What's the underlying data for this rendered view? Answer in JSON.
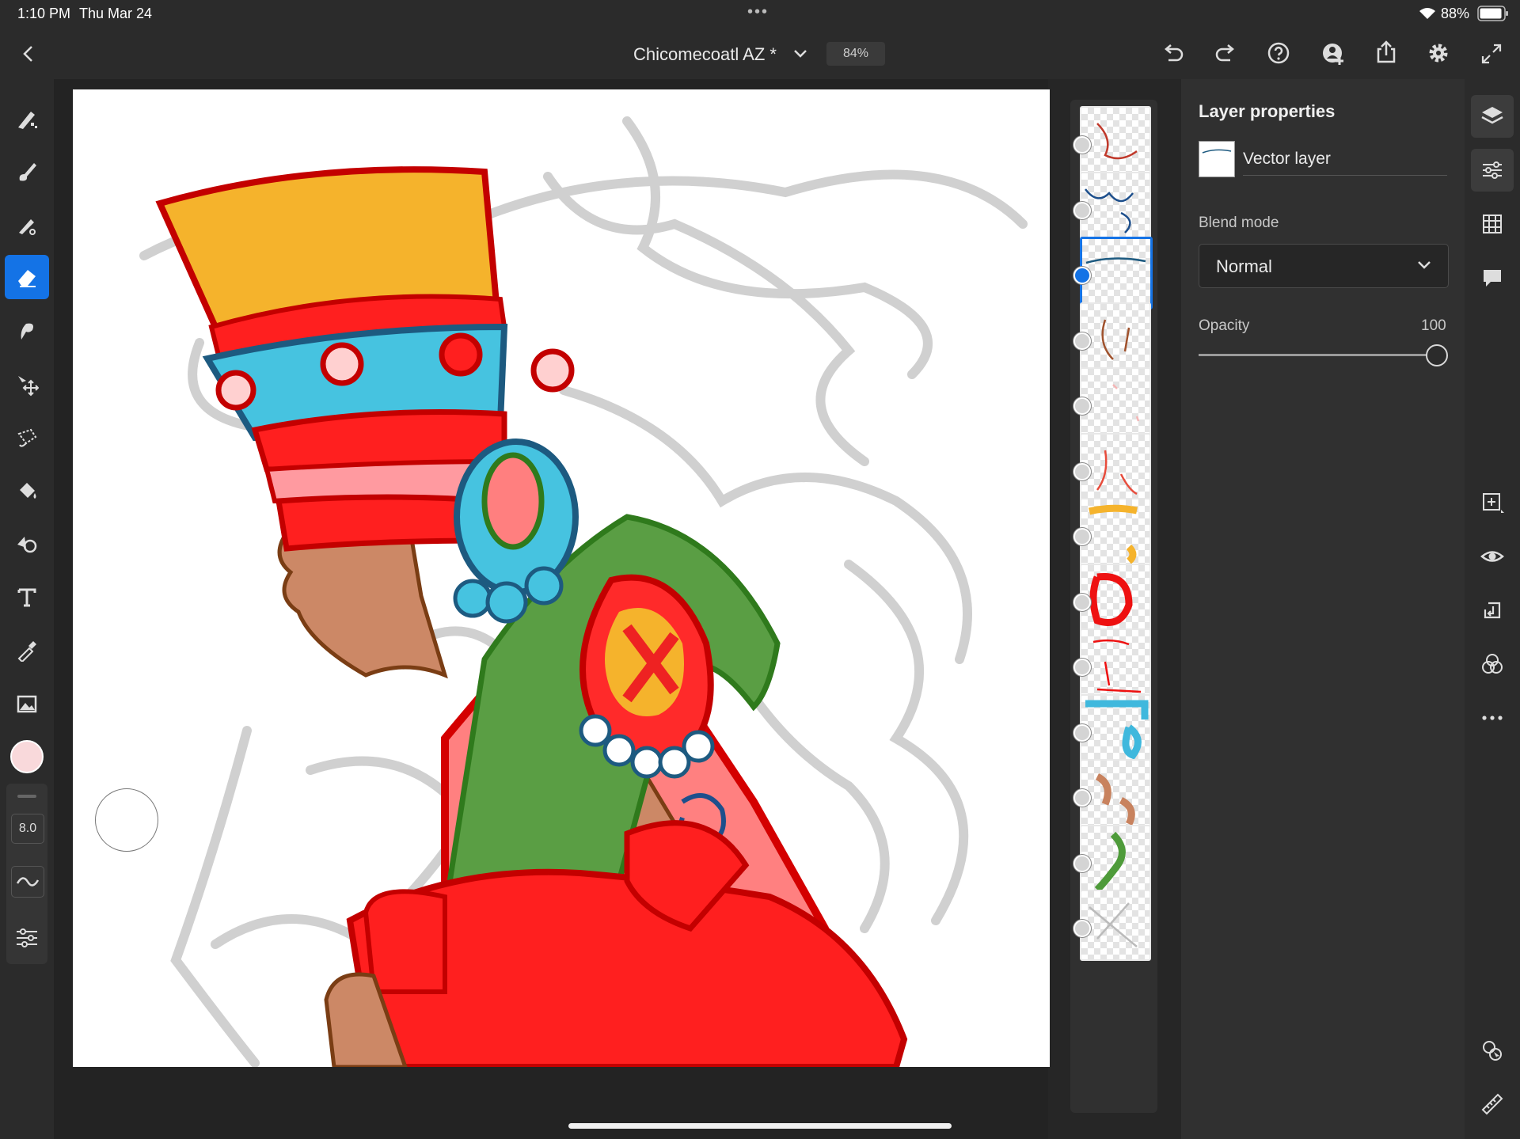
{
  "status_bar": {
    "time": "1:10 PM",
    "date": "Thu Mar 24",
    "dots": "•••",
    "battery": "88%"
  },
  "document": {
    "title": "Chicomecoatl AZ *",
    "zoom": "84%"
  },
  "toolbar": {
    "tools": [
      "pixel-brush",
      "live-brush",
      "vector-brush",
      "eraser",
      "smudge",
      "move",
      "lasso-select",
      "fill",
      "shape",
      "text",
      "eyedropper",
      "image",
      "color-swatch"
    ],
    "active_tool": "eraser",
    "current_color": "#f9d9db",
    "brush_size": "8.0"
  },
  "layers": {
    "count": 13,
    "selected_index": 2,
    "thumb_colors": [
      "#c0392b",
      "#1d4f8c",
      "#1d5a80",
      "#a0522d",
      "#f4b6b6",
      "#e74c3c",
      "#f5b32c",
      "#e11",
      "#e11",
      "#3fb8dd",
      "#c8825e",
      "#4e9b3a",
      "#bbbbbb"
    ]
  },
  "properties": {
    "title": "Layer properties",
    "layer_name": "Vector layer",
    "blend_label": "Blend mode",
    "blend_value": "Normal",
    "opacity_label": "Opacity",
    "opacity_value": "100",
    "opacity_fraction": 1.0
  },
  "colors": {
    "accent": "#1473e6"
  }
}
